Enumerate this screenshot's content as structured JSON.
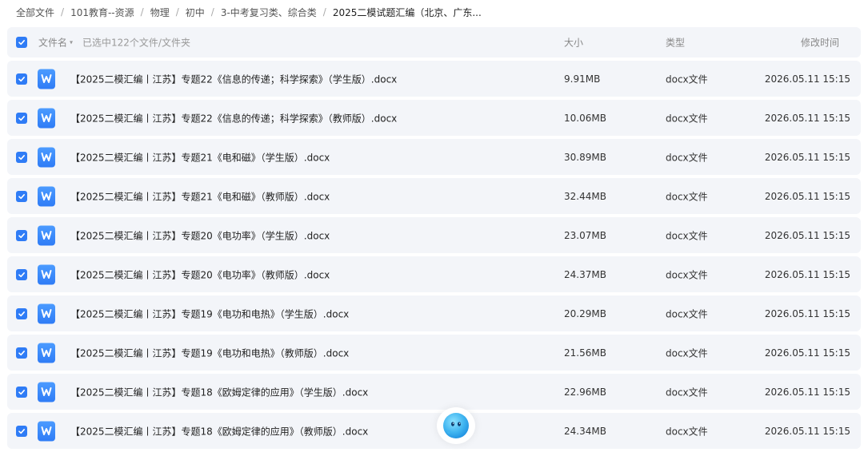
{
  "breadcrumb": [
    {
      "label": "全部文件"
    },
    {
      "label": "101教育--资源"
    },
    {
      "label": "物理"
    },
    {
      "label": "初中"
    },
    {
      "label": "3-中考复习类、综合类"
    },
    {
      "label": "2025二模试题汇编（北京、广东..."
    }
  ],
  "header": {
    "name_label": "文件名",
    "selected_text": "已选中122个文件/文件夹",
    "size_label": "大小",
    "type_label": "类型",
    "mtime_label": "修改时间"
  },
  "files": [
    {
      "name": "【2025二模汇编丨江苏】专题22《信息的传递；科学探索》（学生版）.docx",
      "size": "9.91MB",
      "type": "docx文件",
      "mtime": "2026.05.11 15:15",
      "checked": true,
      "icon": "word-doc-icon"
    },
    {
      "name": "【2025二模汇编丨江苏】专题22《信息的传递；科学探索》（教师版）.docx",
      "size": "10.06MB",
      "type": "docx文件",
      "mtime": "2026.05.11 15:15",
      "checked": true,
      "icon": "word-doc-icon"
    },
    {
      "name": "【2025二模汇编丨江苏】专题21《电和磁》（学生版）.docx",
      "size": "30.89MB",
      "type": "docx文件",
      "mtime": "2026.05.11 15:15",
      "checked": true,
      "icon": "word-doc-icon"
    },
    {
      "name": "【2025二模汇编丨江苏】专题21《电和磁》（教师版）.docx",
      "size": "32.44MB",
      "type": "docx文件",
      "mtime": "2026.05.11 15:15",
      "checked": true,
      "icon": "word-doc-icon"
    },
    {
      "name": "【2025二模汇编丨江苏】专题20《电功率》（学生版）.docx",
      "size": "23.07MB",
      "type": "docx文件",
      "mtime": "2026.05.11 15:15",
      "checked": true,
      "icon": "word-doc-icon"
    },
    {
      "name": "【2025二模汇编丨江苏】专题20《电功率》（教师版）.docx",
      "size": "24.37MB",
      "type": "docx文件",
      "mtime": "2026.05.11 15:15",
      "checked": true,
      "icon": "word-doc-icon"
    },
    {
      "name": "【2025二模汇编丨江苏】专题19《电功和电热》（学生版）.docx",
      "size": "20.29MB",
      "type": "docx文件",
      "mtime": "2026.05.11 15:15",
      "checked": true,
      "icon": "word-doc-icon"
    },
    {
      "name": "【2025二模汇编丨江苏】专题19《电功和电热》（教师版）.docx",
      "size": "21.56MB",
      "type": "docx文件",
      "mtime": "2026.05.11 15:15",
      "checked": true,
      "icon": "word-doc-icon"
    },
    {
      "name": "【2025二模汇编丨江苏】专题18《欧姆定律的应用》（学生版）.docx",
      "size": "22.96MB",
      "type": "docx文件",
      "mtime": "2026.05.11 15:15",
      "checked": true,
      "icon": "word-doc-icon"
    },
    {
      "name": "【2025二模汇编丨江苏】专题18《欧姆定律的应用》（教师版）.docx",
      "size": "24.34MB",
      "type": "docx文件",
      "mtime": "2026.05.11 15:15",
      "checked": true,
      "icon": "word-doc-icon"
    }
  ],
  "colors": {
    "accent": "#2f7cf6",
    "row_bg": "#f3f5f9",
    "assistant": "#3fb4f0"
  },
  "assistant": {
    "icon": "ai-assistant-icon"
  }
}
